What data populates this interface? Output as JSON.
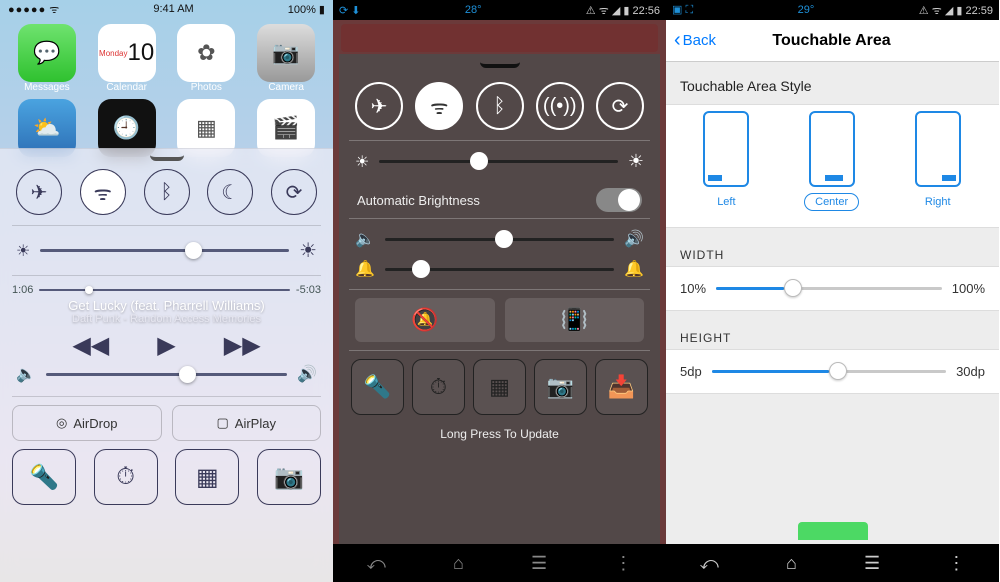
{
  "phone1": {
    "status": {
      "carrier_dots": "●●●●●",
      "wifi": "wifi",
      "time": "9:41 AM",
      "battery_pct": "100%"
    },
    "apps": [
      {
        "name": "Messages",
        "icon": "💬",
        "bg": "linear-gradient(#6fe36f,#2fc12f)"
      },
      {
        "name": "Calendar",
        "icon": "10",
        "sub": "Monday",
        "bg": "#fff"
      },
      {
        "name": "Photos",
        "icon": "✿",
        "bg": "#fff"
      },
      {
        "name": "Camera",
        "icon": "📷",
        "bg": "linear-gradient(#ddd,#999)"
      },
      {
        "name": "Weather",
        "icon": "⛅",
        "bg": "linear-gradient(#4aa3e0,#2d6fb5)"
      },
      {
        "name": "Clock",
        "icon": "🕘",
        "bg": "#111"
      },
      {
        "name": "Files",
        "icon": "▦",
        "bg": "#fff"
      },
      {
        "name": "Videos",
        "icon": "🎬",
        "bg": "#fff"
      }
    ],
    "toggles": [
      "airplane",
      "wifi",
      "bluetooth",
      "dnd",
      "rotation-lock"
    ],
    "toggle_on_index": 1,
    "brightness_pct": 58,
    "scrub": {
      "elapsed": "1:06",
      "remaining": "-5:03",
      "pct": 18
    },
    "now_playing": {
      "title": "Get Lucky (feat. Pharrell Williams)",
      "subtitle": "Daft Punk - Random Access Memories"
    },
    "volume_pct": 55,
    "services": {
      "airdrop": "AirDrop",
      "airplay": "AirPlay"
    },
    "shortcuts": [
      "flashlight",
      "timer",
      "calculator",
      "camera"
    ]
  },
  "phone2": {
    "status": {
      "left": "⟳  ⬇",
      "temp": "28°",
      "time": "22:56"
    },
    "toggles": [
      "airplane",
      "wifi",
      "bluetooth",
      "hotspot",
      "rotation-lock"
    ],
    "toggle_on_index": 1,
    "brightness_pct": 38,
    "auto_brightness_label": "Automatic Brightness",
    "auto_brightness_on": false,
    "volume_pct": 48,
    "ringer_pct": 12,
    "modes": [
      "silent",
      "vibrate"
    ],
    "shortcuts": [
      "flashlight",
      "timer",
      "calculator",
      "camera",
      "inbox"
    ],
    "hint": "Long Press To Update"
  },
  "phone3": {
    "status": {
      "left": "▣ ⛶",
      "temp": "29°",
      "time": "22:59"
    },
    "back": "Back",
    "title": "Touchable Area",
    "style_label": "Touchable Area Style",
    "styles": [
      {
        "key": "left",
        "label": "Left"
      },
      {
        "key": "center",
        "label": "Center"
      },
      {
        "key": "right",
        "label": "Right"
      }
    ],
    "selected_style": "center",
    "width": {
      "label": "WIDTH",
      "min": "10%",
      "max": "100%",
      "pct": 30
    },
    "height": {
      "label": "HEIGHT",
      "min": "5dp",
      "max": "30dp",
      "pct": 50
    }
  }
}
